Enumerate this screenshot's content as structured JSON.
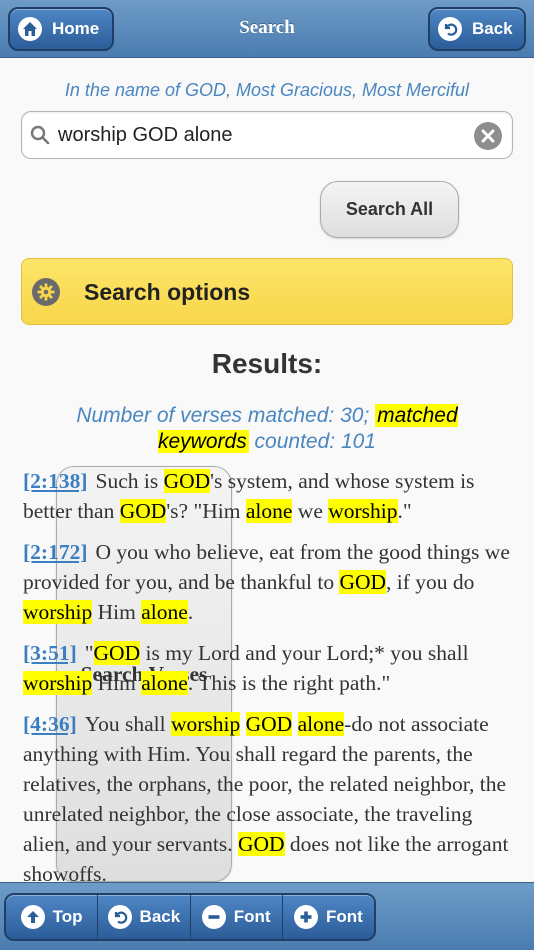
{
  "header": {
    "title": "Search",
    "home_label": "Home",
    "back_label": "Back"
  },
  "basmala": "In the name of GOD, Most Gracious, Most Merciful",
  "search": {
    "value": "worship GOD alone"
  },
  "buttons": {
    "search_verses": "Search Verses",
    "search_all": "Search All"
  },
  "options": {
    "label": "Search options"
  },
  "results": {
    "title": "Results:",
    "summary_part1": "Number of verses matched: 30;",
    "summary_highlight": "matched keywords",
    "summary_part2": "counted: 101"
  },
  "verses": [
    {
      "ref": "[2:138]",
      "segments": [
        {
          "t": "Such is "
        },
        {
          "t": "GOD",
          "h": true
        },
        {
          "t": "'s system, and whose system is better than "
        },
        {
          "t": "GOD",
          "h": true
        },
        {
          "t": "'s? \"Him "
        },
        {
          "t": "alone",
          "h": true
        },
        {
          "t": " we "
        },
        {
          "t": "worship",
          "h": true
        },
        {
          "t": ".\""
        }
      ]
    },
    {
      "ref": "[2:172]",
      "segments": [
        {
          "t": "O you who believe, eat from the good things we provided for you, and be thankful to "
        },
        {
          "t": "GOD",
          "h": true
        },
        {
          "t": ", if you do "
        },
        {
          "t": "worship",
          "h": true
        },
        {
          "t": " Him "
        },
        {
          "t": "alone",
          "h": true
        },
        {
          "t": "."
        }
      ]
    },
    {
      "ref": "[3:51]",
      "segments": [
        {
          "t": "\""
        },
        {
          "t": "GOD",
          "h": true
        },
        {
          "t": " is my Lord and your Lord;* you shall "
        },
        {
          "t": "worship",
          "h": true
        },
        {
          "t": " Him "
        },
        {
          "t": "alone",
          "h": true
        },
        {
          "t": ". This is the right path.\""
        }
      ]
    },
    {
      "ref": "[4:36]",
      "segments": [
        {
          "t": "You shall "
        },
        {
          "t": "worship",
          "h": true
        },
        {
          "t": " "
        },
        {
          "t": "GOD",
          "h": true
        },
        {
          "t": " "
        },
        {
          "t": "alone",
          "h": true
        },
        {
          "t": "-do not associate anything with Him. You shall regard the parents, the relatives, the orphans, the poor, the related neighbor, the unrelated neighbor, the close associate, the traveling alien, and your servants. "
        },
        {
          "t": "GOD",
          "h": true
        },
        {
          "t": " does not like the arrogant showoffs."
        }
      ]
    }
  ],
  "footer": {
    "top_label": "Top",
    "back_label": "Back",
    "font_minus_label": "Font",
    "font_plus_label": "Font"
  },
  "colors": {
    "header_blue": "#4a7cb0",
    "highlight": "#fefe00",
    "options_yellow": "#f7d64a",
    "link_blue": "#3b7fc0"
  }
}
